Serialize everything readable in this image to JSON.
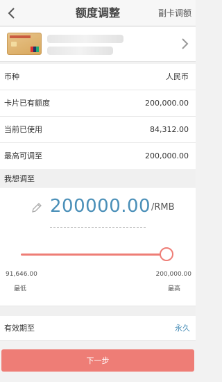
{
  "nav": {
    "title": "额度调整",
    "right_label": "副卡调额",
    "back_icon": "chevron-left-icon"
  },
  "card": {
    "chevron_icon": "chevron-right-icon"
  },
  "info_rows": [
    {
      "label": "币种",
      "value": "人民币"
    },
    {
      "label": "卡片已有额度",
      "value": "200,000.00"
    },
    {
      "label": "当前已使用",
      "value": "84,312.00"
    },
    {
      "label": "最高可调至",
      "value": "200,000.00"
    }
  ],
  "adjust": {
    "section_title": "我想调至",
    "amount": "200000.00",
    "unit": "/RMB",
    "min_value": "91,646.00",
    "min_label": "最低",
    "max_value": "200,000.00",
    "max_label": "最高",
    "slider_fraction": 1.0
  },
  "validity": {
    "label": "有效期至",
    "value": "永久"
  },
  "next_button": "下一步",
  "colors": {
    "accent": "#ee7d76",
    "amount_blue": "#4a8fb8"
  }
}
